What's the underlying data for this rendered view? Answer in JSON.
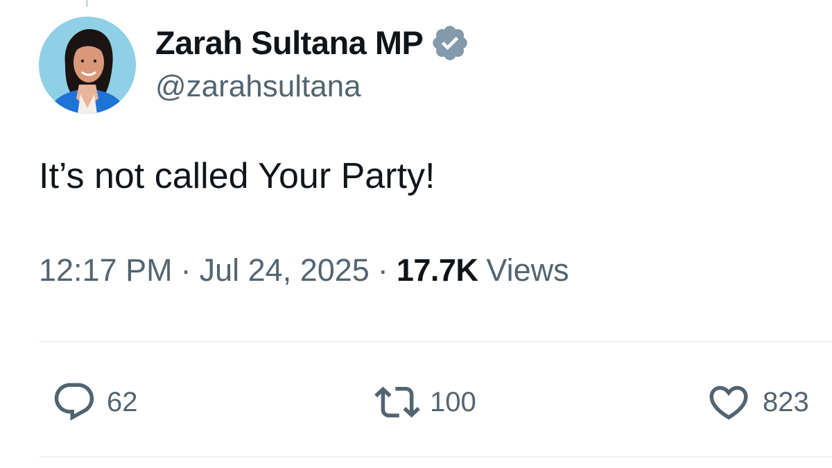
{
  "author": {
    "display_name": "Zarah Sultana MP",
    "handle": "@zarahsultana",
    "verified": true
  },
  "tweet": {
    "text": "It’s not called Your Party!"
  },
  "meta": {
    "time": "12:17 PM",
    "separator": "·",
    "date": "Jul 24, 2025",
    "views_count": "17.7K",
    "views_label": "Views"
  },
  "actions": {
    "reply": {
      "icon": "reply-icon",
      "count": "62"
    },
    "retweet": {
      "icon": "retweet-icon",
      "count": "100"
    },
    "like": {
      "icon": "heart-icon",
      "count": "823"
    }
  },
  "colors": {
    "primary_text": "#0f1419",
    "secondary_text": "#536471",
    "divider": "#eff3f4",
    "verified_badge": "#829aab",
    "avatar_background": "#8fd0e6",
    "jacket": "#1f72d6"
  }
}
